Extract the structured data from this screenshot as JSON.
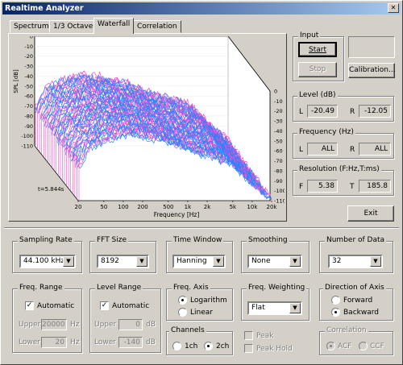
{
  "window": {
    "title": "Realtime Analyzer"
  },
  "tabs": [
    {
      "label": "Spectrum",
      "active": false
    },
    {
      "label": "1/3 Octave",
      "active": false
    },
    {
      "label": "Waterfall",
      "active": true
    },
    {
      "label": "Correlation",
      "active": false
    }
  ],
  "chart_data": {
    "type": "line",
    "ylabel": "SPL [dB]",
    "xlabel": "Frequency [Hz]",
    "y_ticks": [
      "0",
      "-10",
      "-20",
      "-30",
      "-40",
      "-50",
      "-60",
      "-70",
      "-80",
      "-90",
      "-100",
      "-110"
    ],
    "x_ticks": [
      "20",
      "50",
      "100",
      "200",
      "500",
      "1k",
      "2k",
      "5k",
      "10k",
      "20k"
    ],
    "depth_y_ticks": [
      "0",
      "-10",
      "-20",
      "-30",
      "-40",
      "-50",
      "-60",
      "-70",
      "-80",
      "-90",
      "-100",
      "-110"
    ],
    "time_label": "t=5.844s",
    "ylim": [
      -110,
      0
    ],
    "xlim": [
      20,
      20000
    ],
    "x_scale": "log",
    "series": [
      {
        "colors": [
          "#ff44cc",
          "#1e88ff"
        ]
      }
    ],
    "profile_hz": [
      20,
      30,
      50,
      100,
      200,
      500,
      1000,
      2000,
      5000,
      10000,
      20000
    ],
    "profile_db": [
      -72,
      -52,
      -45,
      -38,
      -40,
      -46,
      -54,
      -60,
      -68,
      -88,
      -104
    ],
    "colors": {
      "channel_l": "#ff44cc",
      "channel_r": "#1e88ff",
      "plot_bg": "#ffffff",
      "wall": "#c8c8c8"
    }
  },
  "input": {
    "label": "Input",
    "start": "Start",
    "stop": "Stop",
    "calibration": "Calibration..."
  },
  "level": {
    "label": "Level (dB)",
    "l_label": "L",
    "l_value": "-20.49",
    "r_label": "R",
    "r_value": "-12.05"
  },
  "frequency": {
    "label": "Frequency (Hz)",
    "l_label": "L",
    "l_value": "ALL",
    "r_label": "R",
    "r_value": "ALL"
  },
  "resolution": {
    "label": "Resolution (F:Hz,T:ms)",
    "f_label": "F",
    "f_value": "5.38",
    "t_label": "T",
    "t_value": "185.8"
  },
  "exit_label": "Exit",
  "sampling_rate": {
    "label": "Sampling Rate",
    "value": "44.100 kHz"
  },
  "fft_size": {
    "label": "FFT Size",
    "value": "8192"
  },
  "time_window": {
    "label": "Time Window",
    "value": "Hanning"
  },
  "smoothing": {
    "label": "Smoothing",
    "value": "None"
  },
  "num_data": {
    "label": "Number of Data",
    "value": "32"
  },
  "freq_range": {
    "label": "Freq. Range",
    "automatic": "Automatic",
    "upper_label": "Upper",
    "upper_value": "20000",
    "upper_unit": "Hz",
    "lower_label": "Lower",
    "lower_value": "20",
    "lower_unit": "Hz"
  },
  "level_range": {
    "label": "Level Range",
    "automatic": "Automatic",
    "upper_label": "Upper",
    "upper_value": "0",
    "upper_unit": "dB",
    "lower_label": "Lower",
    "lower_value": "-140",
    "lower_unit": "dB"
  },
  "freq_axis": {
    "label": "Freq. Axis",
    "log": "Logarithm",
    "linear": "Linear"
  },
  "channels": {
    "label": "Channels",
    "ch1": "1ch",
    "ch2": "2ch"
  },
  "freq_weighting": {
    "label": "Freq. Weighting",
    "value": "Flat"
  },
  "peak": {
    "peak": "Peak",
    "peak_hold": "Peak Hold"
  },
  "direction": {
    "label": "Direction of Axis",
    "forward": "Forward",
    "backward": "Backward"
  },
  "correlation": {
    "label": "Correlation",
    "acf": "ACF",
    "ccf": "CCF"
  }
}
